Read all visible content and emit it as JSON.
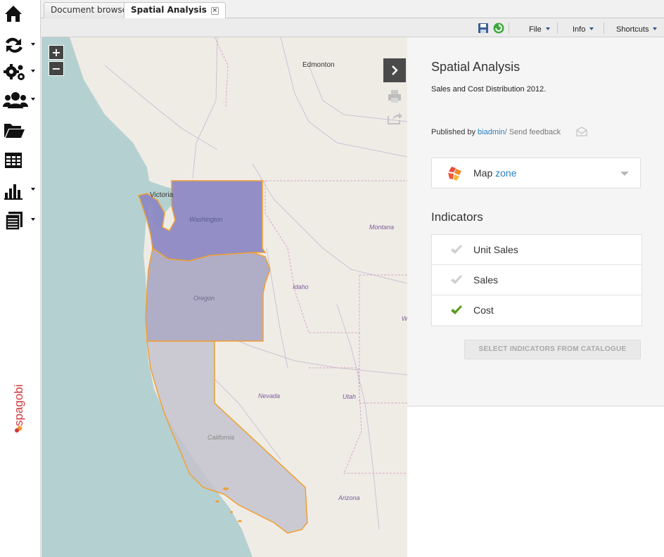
{
  "tabs": [
    {
      "label": "Document browser",
      "active": false
    },
    {
      "label": "Spatial Analysis",
      "active": true
    }
  ],
  "toolbar": {
    "menus": [
      "File",
      "Info",
      "Shortcuts"
    ],
    "icons": [
      "save-icon",
      "refresh-icon"
    ]
  },
  "sidebar": {
    "items": [
      "home-icon",
      "arrows-icon",
      "gears-icon",
      "users-icon",
      "folder-icon",
      "table-icon",
      "bar-chart-icon",
      "documents-icon"
    ],
    "brand": "spagobi"
  },
  "map": {
    "zoom_in": "+",
    "zoom_out": "−",
    "labels": {
      "edmonton": "Edmonton",
      "victoria": "Victoria",
      "washington": "Washington",
      "oregon": "Oregon",
      "idaho": "Idaho",
      "montana": "Montana",
      "nevada": "Nevada",
      "utah": "Utah",
      "california": "California",
      "arizona": "Arizona",
      "wy": "W"
    },
    "region_colors": {
      "washington": "#8b86c2",
      "oregon": "#a9a6c3",
      "california": "#c4c3cc",
      "border": "#f0a032",
      "water": "#b5d0d0",
      "land": "#efece6"
    }
  },
  "panel": {
    "title": "Spatial Analysis",
    "subtitle": "Sales and Cost Distribution 2012.",
    "published_by": "Published by ",
    "author": "biadmin",
    "separator": "/ ",
    "feedback": "Send feedback",
    "map_selector": {
      "prefix": "Map ",
      "value": "zone"
    },
    "indicators_title": "Indicators",
    "indicators": [
      {
        "label": "Unit Sales",
        "checked": false
      },
      {
        "label": "Sales",
        "checked": false
      },
      {
        "label": "Cost",
        "checked": true
      }
    ],
    "catalogue_button": "SELECT INDICATORS FROM CATALOGUE"
  }
}
